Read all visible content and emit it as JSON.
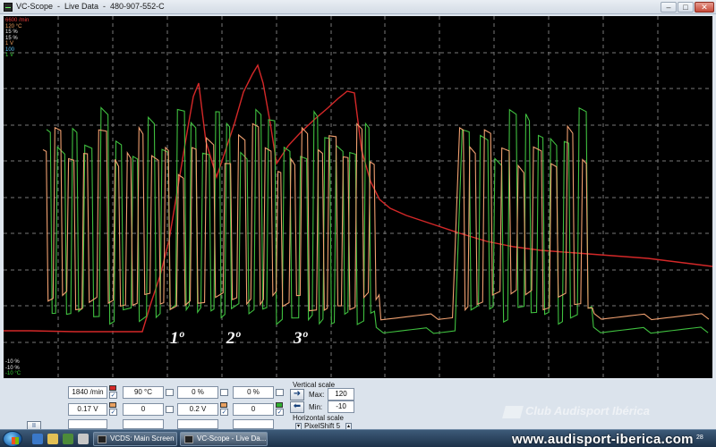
{
  "window": {
    "title": "VC-Scope  -  Live Data  -  480-907-552-C",
    "minimize": "–",
    "maximize": "□",
    "close": "✕"
  },
  "scope": {
    "legend_top": [
      {
        "text": "6600 /min",
        "color": "#e83a3a"
      },
      {
        "text": "120 °C",
        "color": "#f0a060"
      },
      {
        "text": "15 %",
        "color": "#f0f0f0"
      },
      {
        "text": "15 %",
        "color": "#f0f0f0"
      },
      {
        "text": "1 V",
        "color": "#f0a060"
      },
      {
        "text": "100",
        "color": "#5ec8ff"
      },
      {
        "text": "1 V",
        "color": "#3ad13a"
      },
      {
        "text": "",
        "color": "#3ad13a"
      }
    ],
    "legend_bottom": [
      {
        "text": "-10 %",
        "color": "#f0f0f0"
      },
      {
        "text": "-10 %",
        "color": "#f0f0f0"
      },
      {
        "text": "-10 °C",
        "color": "#3ad13a"
      }
    ],
    "annotations": [
      "1º",
      "2º",
      "3º"
    ],
    "colors": {
      "rpm": "#d42828",
      "lambda_orange": "#f0a070",
      "lambda_green": "#3fbf3f",
      "grid": "#777777"
    }
  },
  "panel": {
    "channels_row1": [
      "1840 /min",
      "90 °C",
      "0 %",
      "0 %"
    ],
    "channels_row2": [
      "0.17 V",
      "0",
      "0.2 V",
      "0"
    ],
    "swatch_colors": [
      "#d42828",
      "#e8a060",
      "#e8a060",
      "#2fae2f"
    ],
    "vertical_scale_label": "Vertical scale",
    "max_label": "Max:",
    "max_value": "120",
    "min_label": "Min:",
    "min_value": "-10",
    "horizontal_scale_label": "Horizontal scale",
    "pixelshift_label": "PixelShift 5",
    "pause_label": "II",
    "check": "✓"
  },
  "watermark": {
    "club_text": "Club Audisport Ibérica",
    "url": "www.audisport-iberica.com"
  },
  "taskbar": {
    "tasks": [
      {
        "label": "VCDS:  Main Screen",
        "active": false
      },
      {
        "label": "VC-Scope  -  Live Da...",
        "active": true
      }
    ],
    "clock": "28"
  }
}
